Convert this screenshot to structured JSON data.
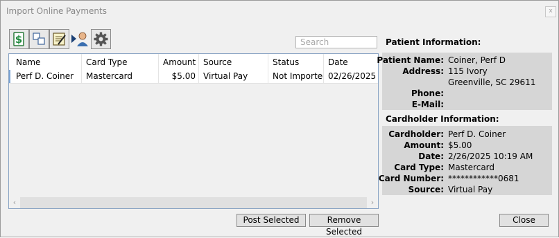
{
  "window": {
    "title": "Import Online Payments",
    "close_glyph": "x"
  },
  "toolbar": {
    "icons": [
      "payment-dollar-icon",
      "copy-pages-icon",
      "edit-notes-icon",
      "assign-user-icon",
      "settings-gear-icon"
    ]
  },
  "search": {
    "placeholder": "Search",
    "value": ""
  },
  "grid": {
    "columns": [
      "Name",
      "Card Type",
      "Amount",
      "Source",
      "Status",
      "Date"
    ],
    "rows": [
      {
        "name": "Perf D. Coiner",
        "card_type": "Mastercard",
        "amount": "$5.00",
        "source": "Virtual Pay",
        "status": "Not Imported",
        "date": "02/26/2025"
      }
    ]
  },
  "patient": {
    "heading": "Patient Information:",
    "labels": {
      "name": "Patient Name:",
      "address": "Address:",
      "phone": "Phone:",
      "email": "E-Mail:"
    },
    "name": "Coiner, Perf D",
    "address_line1": "115 Ivory",
    "address_line2": "Greenville, SC 29611",
    "phone": "",
    "email": ""
  },
  "cardholder": {
    "heading": "Cardholder Information:",
    "labels": {
      "cardholder": "Cardholder:",
      "amount": "Amount:",
      "date": "Date:",
      "card_type": "Card Type:",
      "card_number": "Card Number:",
      "source": "Source:"
    },
    "cardholder": "Perf D. Coiner",
    "amount": "$5.00",
    "date": "2/26/2025 10:19 AM",
    "card_type": "Mastercard",
    "card_number": "************0681",
    "source": "Virtual Pay"
  },
  "buttons": {
    "post_selected": "Post Selected",
    "remove_selected": "Remove Selected",
    "close": "Close"
  },
  "scroll": {
    "left": "‹",
    "right": "›"
  }
}
